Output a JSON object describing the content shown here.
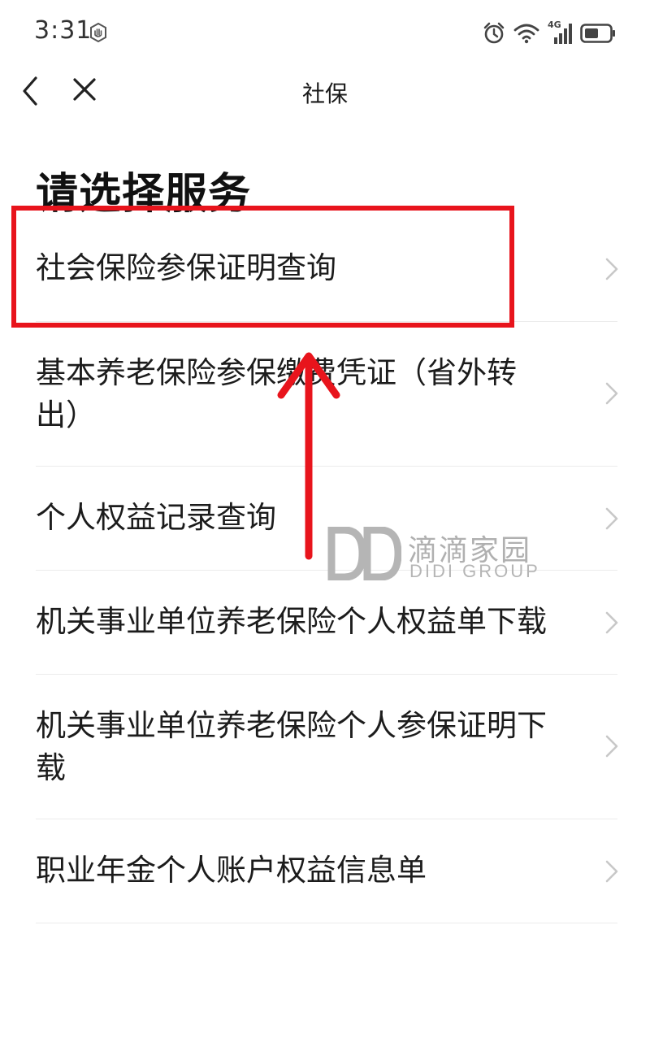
{
  "status_bar": {
    "time": "3:31",
    "network_label": "4G",
    "icons": [
      "hand-shield-icon",
      "alarm-icon",
      "wifi-icon",
      "signal-icon",
      "battery-icon"
    ]
  },
  "nav": {
    "title": "社保"
  },
  "heading": "请选择服务",
  "services": [
    {
      "label": "社会保险参保证明查询"
    },
    {
      "label": "基本养老保险参保缴费凭证（省外转出）"
    },
    {
      "label": "个人权益记录查询"
    },
    {
      "label": "机关事业单位养老保险个人权益单下载"
    },
    {
      "label": "机关事业单位养老保险个人参保证明下载"
    },
    {
      "label": "职业年金个人账户权益信息单"
    }
  ],
  "watermark": {
    "cn": "滴滴家园",
    "en": "DIDI GROUP"
  },
  "colors": {
    "annotation_red": "#e8141c",
    "chevron": "#c8c8c8",
    "divider": "#ececec",
    "watermark_gray": "#b0b0b0"
  }
}
